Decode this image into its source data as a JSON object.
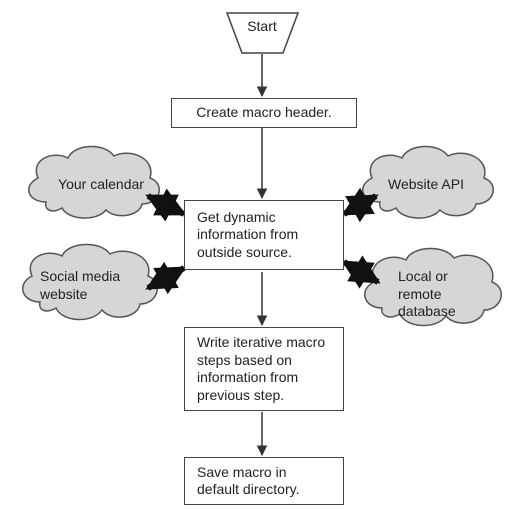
{
  "diagram": {
    "start": "Start",
    "step1": "Create macro header.",
    "step2": "Get dynamic information from outside source.",
    "step3": "Write iterative macro steps based on information from previous step.",
    "step4": "Save macro in default directory.",
    "clouds": {
      "topLeft": "Your calendar",
      "bottomLeft": "Social media website",
      "topRight": "Website API",
      "bottomRight": "Local or remote database"
    }
  }
}
